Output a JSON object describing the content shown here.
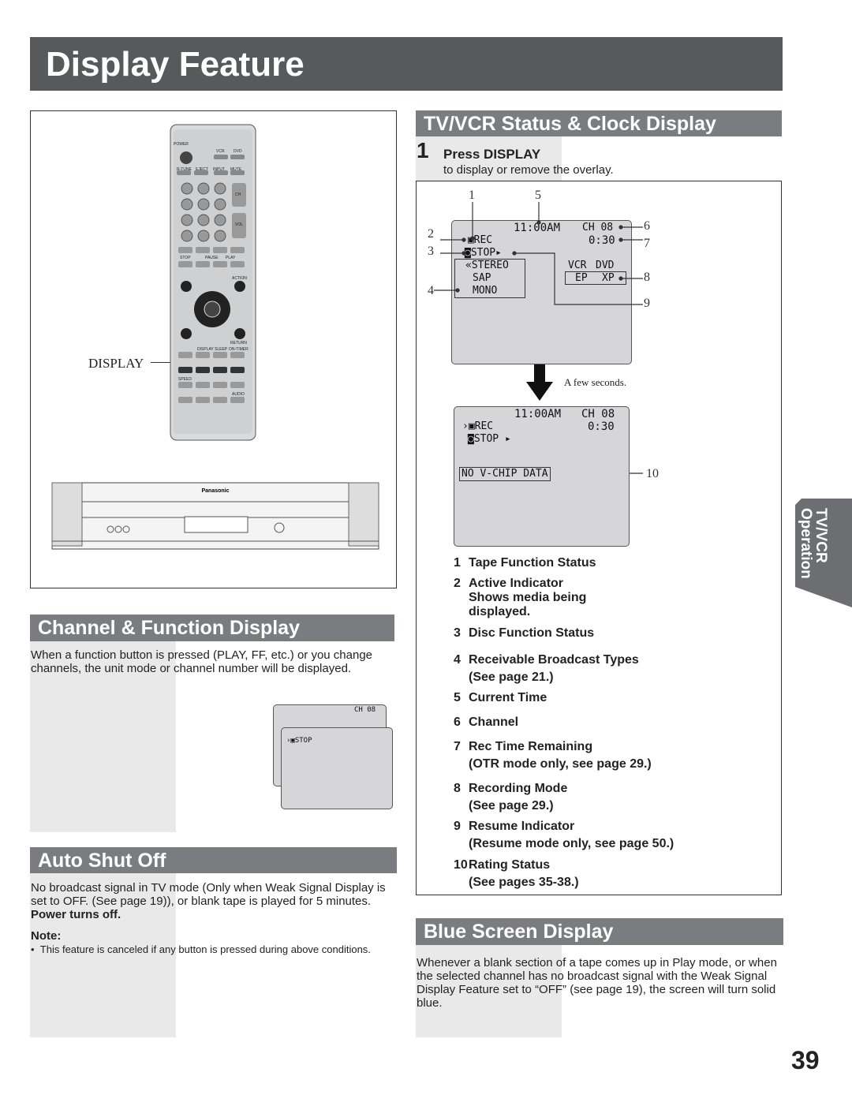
{
  "page_title": "Display Feature",
  "page_number": "39",
  "side_tab": {
    "line1": "TV/VCR",
    "line2": "Operation"
  },
  "left_panel": {
    "callout_label": "DISPLAY",
    "remote_labels": [
      "POWER",
      "VCR",
      "DVD",
      "R-TUNE",
      "EJECT",
      "INPUT",
      "MUTE",
      "CH",
      "VOL",
      "STOP",
      "PAUSE",
      "PLAY",
      "ACTION",
      "ENTER SET",
      "RETURN",
      "DISPLAY",
      "SLEEP",
      "ON-TIMER",
      "SPEED",
      "AUDIO"
    ],
    "vcr_brand": "Panasonic"
  },
  "channel_section": {
    "title": "Channel & Function Display",
    "text": "When a function button is pressed (PLAY, FF, etc.) or you change channels, the unit mode or channel number will be displayed.",
    "screen_back": "CH 08",
    "screen_front": "STOP"
  },
  "auto_shut_off": {
    "title": "Auto Shut Off",
    "text": "No broadcast signal in TV mode (Only when Weak Signal Display is set to OFF. (See page 19)), or blank tape is played for 5 minutes.",
    "bold_text": "Power turns off.",
    "note_label": "Note:",
    "note": "This feature is canceled if any button is pressed during above conditions."
  },
  "status_section": {
    "title": "TV/VCR Status & Clock Display",
    "step_number": "1",
    "step_title": "Press DISPLAY",
    "step_text": "to display or remove the overlay.",
    "screen1": {
      "time": "11:00AM",
      "channel": "CH 08",
      "rec": "REC",
      "remaining": "0:30",
      "stop": "STOP",
      "stereo": "STEREO",
      "sap": "SAP",
      "mono": "MONO",
      "vcr": "VCR",
      "dvd": "DVD",
      "ep": "EP",
      "xp": "XP"
    },
    "callouts": [
      "1",
      "2",
      "3",
      "4",
      "5",
      "6",
      "7",
      "8",
      "9",
      "10"
    ],
    "arrow_caption": "A few seconds.",
    "screen2": {
      "time": "11:00AM",
      "channel": "CH 08",
      "rec": "REC",
      "remaining": "0:30",
      "stop": "STOP",
      "vchip": "NO V-CHIP DATA"
    },
    "items": [
      {
        "n": "1",
        "title": "Tape Function Status"
      },
      {
        "n": "2",
        "title": "Active Indicator",
        "sub": "Shows media being displayed."
      },
      {
        "n": "3",
        "title": "Disc Function Status"
      },
      {
        "n": "4",
        "title": "Receivable Broadcast Types",
        "sub": "(See page 21.)"
      },
      {
        "n": "5",
        "title": "Current Time"
      },
      {
        "n": "6",
        "title": "Channel"
      },
      {
        "n": "7",
        "title": "Rec Time Remaining",
        "sub": "(OTR mode only, see page 29.)"
      },
      {
        "n": "8",
        "title": "Recording Mode",
        "sub": "(See page 29.)"
      },
      {
        "n": "9",
        "title": "Resume Indicator",
        "sub": "(Resume mode only, see page 50.)"
      },
      {
        "n": "10",
        "title": "Rating Status",
        "sub": "(See pages 35-38.)"
      }
    ]
  },
  "blue_screen": {
    "title": "Blue Screen Display",
    "text": "Whenever a blank section of a tape comes up in Play mode, or when the selected channel has no broadcast signal with the Weak Signal Display Feature set to “OFF” (see page 19), the screen will turn solid blue."
  },
  "colors": {
    "header_bg": "#58595b",
    "section_bg": "#7b7c7f",
    "band_bg": "#e9e9ea",
    "screen_bg": "#d6d6d8"
  }
}
